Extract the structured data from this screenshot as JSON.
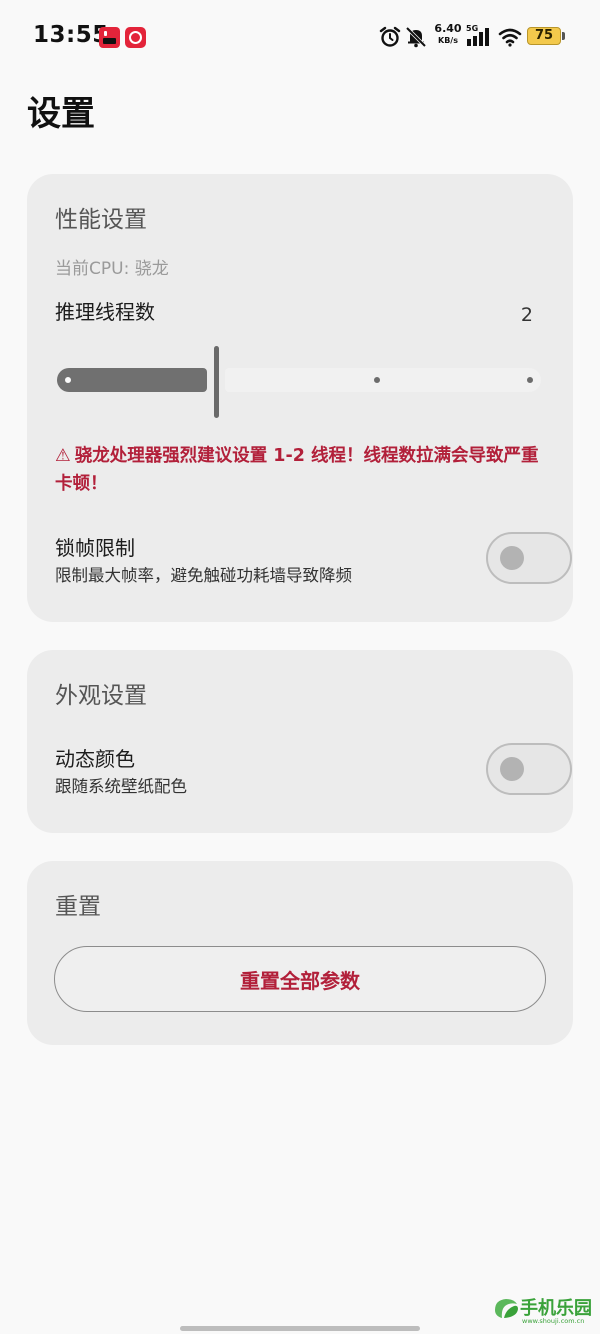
{
  "status_bar": {
    "time": "13:55",
    "app_icons": [
      "app-icon-red-1",
      "netease-music-icon"
    ],
    "net_speed_value": "6.40",
    "net_speed_unit": "KB/s",
    "network_type": "5G",
    "battery_level": "75",
    "icons": [
      "alarm-icon",
      "mute-icon",
      "signal-icon",
      "wifi-icon",
      "battery-icon"
    ]
  },
  "page": {
    "title": "设置"
  },
  "performance": {
    "title": "性能设置",
    "cpu_label": "当前CPU: 骁龙",
    "threads_label": "推理线程数",
    "threads_value": "2",
    "slider": {
      "value": 2,
      "min": 1,
      "max": 4,
      "steps": 4
    },
    "warning_icon": "⚠",
    "warning_text": "骁龙处理器强烈建议设置 1-2 线程！线程数拉满会导致严重卡顿！",
    "frame_limit": {
      "title": "锁帧限制",
      "description": "限制最大帧率，避免触碰功耗墙导致降频",
      "enabled": false
    }
  },
  "appearance": {
    "title": "外观设置",
    "dynamic_color": {
      "title": "动态颜色",
      "description": "跟随系统壁纸配色",
      "enabled": false
    }
  },
  "reset": {
    "title": "重置",
    "button_label": "重置全部参数"
  },
  "watermark": {
    "name": "手机乐园",
    "url": "www.shouji.com.cn"
  },
  "colors": {
    "accent_red": "#b2203a",
    "card_bg": "#ececec",
    "page_bg": "#f9f9f9",
    "watermark_green": "#3aa23a"
  }
}
